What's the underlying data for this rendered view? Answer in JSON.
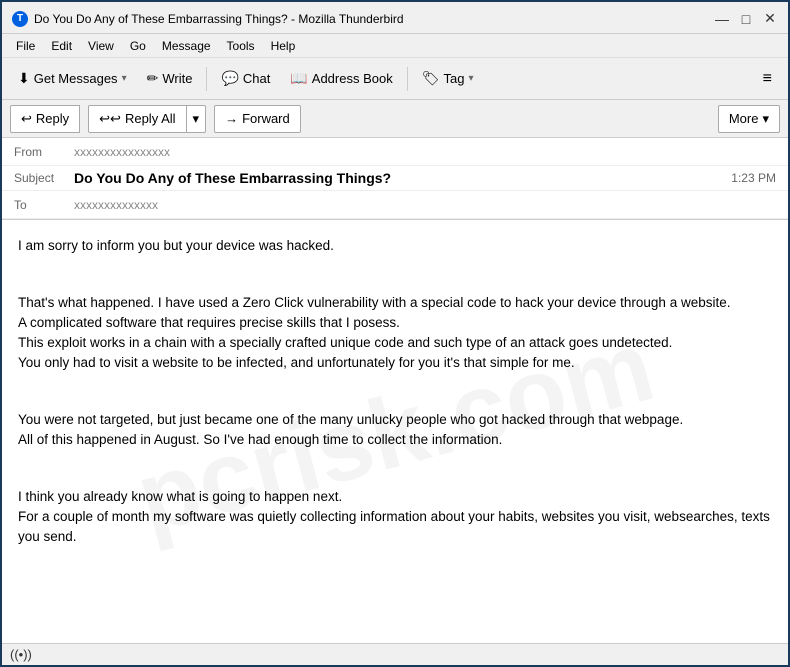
{
  "window": {
    "title": "Do You Do Any of These Embarrassing Things? - Mozilla Thunderbird"
  },
  "menu": {
    "items": [
      "File",
      "Edit",
      "View",
      "Go",
      "Message",
      "Tools",
      "Help"
    ]
  },
  "toolbar": {
    "get_messages": "Get Messages",
    "write": "Write",
    "chat": "Chat",
    "address_book": "Address Book",
    "tag": "Tag"
  },
  "action_bar": {
    "reply": "Reply",
    "reply_all": "Reply All",
    "forward": "Forward",
    "more": "More"
  },
  "email": {
    "from_label": "From",
    "from_value": "xxxxxxxxxxxxxxxx",
    "subject_label": "Subject",
    "subject": "Do You Do Any of These Embarrassing Things?",
    "time": "1:23 PM",
    "to_label": "To",
    "to_value": "xxxxxxxxxxxxxx",
    "body": [
      "I am sorry to inform you but your device was hacked.",
      "That's what happened. I have used a Zero Click vulnerability with a special code to hack your device through a website.\nA complicated software that requires precise skills that I posess.\nThis exploit works in a chain with a specially crafted unique code and such type of an attack goes undetected.\nYou only had to visit a website to be infected, and unfortunately for you it's that simple for me.",
      "You were not targeted, but just became one of the many unlucky people who got hacked through that webpage.\nAll of this happened in August. So I've had enough time to collect the information.",
      "I think you already know what is going to happen next.\nFor a couple of month my software was quietly collecting information about your habits, websites you visit, websearches, texts you send."
    ]
  },
  "status_bar": {
    "wifi_symbol": "((•))"
  },
  "icons": {
    "minimize": "—",
    "maximize": "□",
    "close": "✕",
    "reply_icon": "↩",
    "reply_all_icon": "↩↩",
    "forward_icon": "→",
    "dropdown_arrow": "▾",
    "get_messages_icon": "⬇",
    "write_icon": "✏",
    "chat_icon": "💬",
    "address_book_icon": "📖",
    "tag_icon": "🏷",
    "hamburger": "≡"
  }
}
